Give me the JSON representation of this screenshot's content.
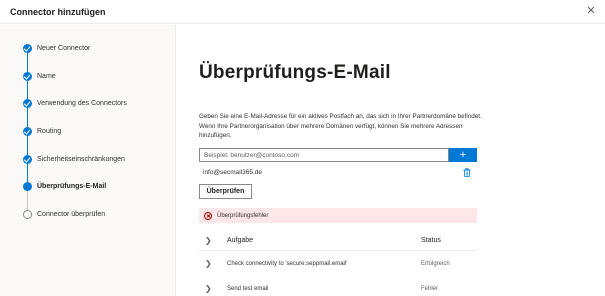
{
  "window": {
    "title": "Connector hinzufügen",
    "close_glyph": "✕"
  },
  "steps": [
    {
      "label": "Neuer Connector",
      "state": "done"
    },
    {
      "label": "Name",
      "state": "done"
    },
    {
      "label": "Verwendung des Connectors",
      "state": "done"
    },
    {
      "label": "Routing",
      "state": "done"
    },
    {
      "label": "Sicherheitseinschränkungen",
      "state": "done"
    },
    {
      "label": "Überprüfungs-E-Mail",
      "state": "current"
    },
    {
      "label": "Connector überprüfen",
      "state": "pending"
    }
  ],
  "main": {
    "heading": "Überprüfungs-E-Mail",
    "description": "Geben Sie eine E-Mail-Adresse für ein aktives Postfach an, das sich in Ihrer Partnerdomäne befindet. Wenn Ihre Partnerorganisation über mehrere Domänen verfügt, können Sie mehrere Adressen hinzufügen.",
    "email_placeholder": "Beispiel: benutzer@contoso.com",
    "add_glyph": "+",
    "entries": [
      "info@secmail365.de"
    ],
    "verify_label": "Überprüfen",
    "error_text": "Überprüfungsfehler",
    "table": {
      "headers": {
        "task": "Aufgabe",
        "status": "Status"
      },
      "rows": [
        {
          "task": "Check connectivity to 'secure.seppmail.email'",
          "status": "Erfolgreich"
        },
        {
          "task": "Send test email",
          "status": "Fehler"
        }
      ]
    }
  },
  "colors": {
    "accent": "#0078d4",
    "error_bg": "#fde7e9",
    "error": "#a80000"
  },
  "icons": [
    "close-icon",
    "check-icon",
    "plus-icon",
    "trash-icon",
    "error-icon",
    "chevron-right-icon"
  ]
}
